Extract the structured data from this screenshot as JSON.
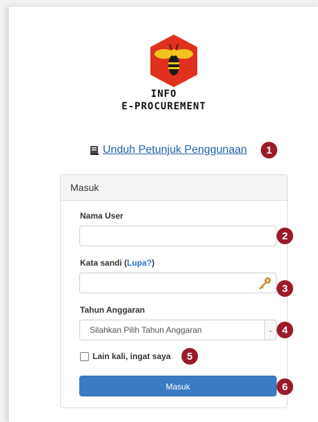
{
  "logo": {
    "line1": "INFO",
    "line2": "E-PROCUREMENT",
    "icon": "bee-hexagon-logo",
    "hex_color": "#e0301e"
  },
  "manual_link": {
    "icon": "book-icon",
    "label": "Unduh Petunjuk Penggunaan"
  },
  "badges": [
    "1",
    "2",
    "3",
    "4",
    "5",
    "6"
  ],
  "login_panel": {
    "heading": "Masuk",
    "username_label": "Nama User",
    "username_value": "",
    "password_label": "Kata sandi (",
    "forgot_link": "Lupa?",
    "password_label_end": ")",
    "password_value": "",
    "password_icon": "key-icon",
    "year_label": "Tahun Anggaran",
    "year_select_value": "Silahkan Pilih Tahun Anggaran",
    "remember_label": "Lain kali, ingat saya",
    "remember_checked": false,
    "submit_label": "Masuk"
  },
  "colors": {
    "badge": "#9a1b2a",
    "primary_button": "#3a7cc3",
    "link": "#1f5fa8"
  }
}
